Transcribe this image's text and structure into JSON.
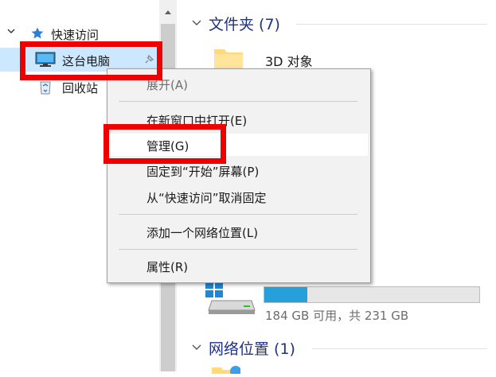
{
  "nav": {
    "quick_access": "快速访问",
    "this_pc": "这台电脑",
    "recycle_bin": "回收站"
  },
  "sections": {
    "folders": "文件夹 (7)",
    "network": "网络位置 (1)"
  },
  "folders": [
    {
      "name": "3D 对象"
    }
  ],
  "drive": {
    "space_text": "184 GB 可用，共 231 GB",
    "used_fraction": 0.2
  },
  "context_menu": {
    "items": [
      {
        "label": "展开(A)",
        "disabled": true
      },
      {
        "label": "在新窗口中打开(E)"
      },
      {
        "label": "管理(G)",
        "highlighted": true
      },
      {
        "label": "固定到“开始”屏幕(P)"
      },
      {
        "label": "从“快速访问”取消固定"
      },
      {
        "label": "添加一个网络位置(L)"
      },
      {
        "label": "属性(R)"
      }
    ]
  },
  "colors": {
    "accent": "#26a0da",
    "highlight_box": "#ee0000",
    "selection": "#cce8ff",
    "section_title": "#1e3287"
  }
}
